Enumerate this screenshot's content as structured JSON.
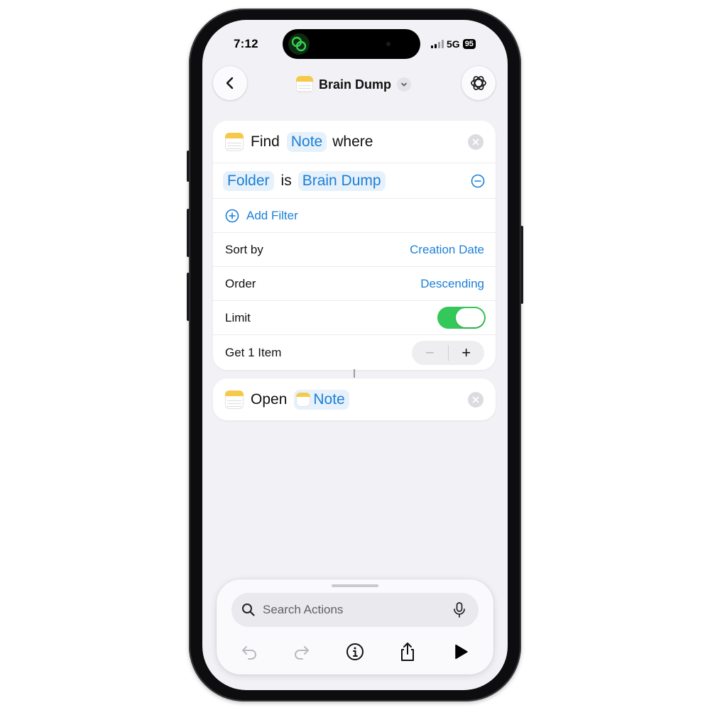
{
  "status_bar": {
    "time": "7:12",
    "network": "5G",
    "battery": "95"
  },
  "header": {
    "title": "Brain Dump"
  },
  "find_action": {
    "verb": "Find",
    "entity": "Note",
    "where_word": "where",
    "filter": {
      "field": "Folder",
      "operator": "is",
      "value": "Brain Dump"
    },
    "add_filter_label": "Add Filter",
    "sort_by": {
      "label": "Sort by",
      "value": "Creation Date"
    },
    "order": {
      "label": "Order",
      "value": "Descending"
    },
    "limit": {
      "label": "Limit",
      "enabled": true
    },
    "get_items": {
      "label": "Get 1 Item",
      "minus": "−",
      "plus": "+"
    }
  },
  "open_action": {
    "verb": "Open",
    "entity": "Note"
  },
  "search": {
    "placeholder": "Search Actions"
  },
  "colors": {
    "accent": "#1b7fd6",
    "toggle_on": "#34c759",
    "notes_yellow": "#f6c94a"
  }
}
